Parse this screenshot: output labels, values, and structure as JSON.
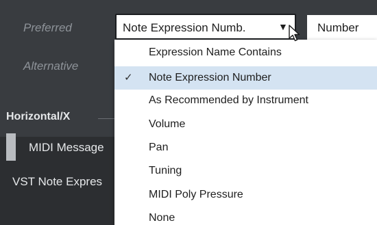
{
  "labels": {
    "preferred": "Preferred",
    "alternative": "Alternative",
    "horizontal_section": "Horizontal/X",
    "midi_message": "MIDI Message",
    "vst_note_expression": "VST Note Expres"
  },
  "dropdown": {
    "selected_value": "Note Expression Numb.",
    "arrow_icon": "triangle-down-icon"
  },
  "number_field": {
    "value": "Number"
  },
  "menu": {
    "items": [
      {
        "label": "Expression Name Contains",
        "checked": false
      },
      {
        "label": "Note Expression Number",
        "checked": true
      },
      {
        "label": "As Recommended by Instrument",
        "checked": false
      },
      {
        "label": "Volume",
        "checked": false
      },
      {
        "label": "Pan",
        "checked": false
      },
      {
        "label": "Tuning",
        "checked": false
      },
      {
        "label": "MIDI Poly Pressure",
        "checked": false
      },
      {
        "label": "None",
        "checked": false
      }
    ],
    "check_icon": "checkmark-icon"
  },
  "colors": {
    "background": "#393c40",
    "selected_item": "#d4e3f2",
    "label_muted": "#8e9399"
  }
}
